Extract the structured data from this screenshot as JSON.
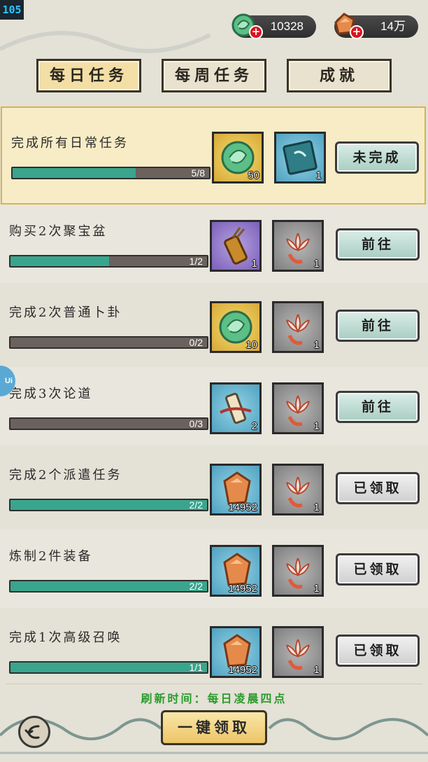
{
  "status": {
    "fps": "105"
  },
  "currency": {
    "jade": {
      "amount": "10328",
      "icon": "jade-coin-icon"
    },
    "crystal": {
      "amount": "14万",
      "icon": "amber-crystal-icon"
    }
  },
  "tabs": [
    {
      "label": "每日任务",
      "active": true
    },
    {
      "label": "每周任务",
      "active": false
    },
    {
      "label": "成就",
      "active": false
    }
  ],
  "tasks": [
    {
      "title": "完成所有日常任务",
      "progress_text": "5/8",
      "progress": 0.625,
      "rewards": [
        {
          "icon": "jade-coin-icon",
          "qty": "50"
        },
        {
          "icon": "scroll-book-icon",
          "qty": "1"
        }
      ],
      "button": "未完成"
    },
    {
      "title": "购买2次聚宝盆",
      "progress_text": "1/2",
      "progress": 0.5,
      "rewards": [
        {
          "icon": "arrow-quiver-icon",
          "qty": "1"
        },
        {
          "icon": "lotus-flower-icon",
          "qty": "1"
        }
      ],
      "button": "前往"
    },
    {
      "title": "完成2次普通卜卦",
      "progress_text": "0/2",
      "progress": 0,
      "rewards": [
        {
          "icon": "jade-coin-icon",
          "qty": "10"
        },
        {
          "icon": "lotus-flower-icon",
          "qty": "1"
        }
      ],
      "button": "前往"
    },
    {
      "title": "完成3次论道",
      "progress_text": "0/3",
      "progress": 0,
      "rewards": [
        {
          "icon": "scroll-tube-icon",
          "qty": "2"
        },
        {
          "icon": "lotus-flower-icon",
          "qty": "1"
        }
      ],
      "button": "前往"
    },
    {
      "title": "完成2个派遣任务",
      "progress_text": "2/2",
      "progress": 1,
      "rewards": [
        {
          "icon": "amber-crystal-icon",
          "qty": "14952"
        },
        {
          "icon": "lotus-flower-icon",
          "qty": "1"
        }
      ],
      "button": "已领取"
    },
    {
      "title": "炼制2件装备",
      "progress_text": "2/2",
      "progress": 1,
      "rewards": [
        {
          "icon": "amber-crystal-icon",
          "qty": "14952"
        },
        {
          "icon": "lotus-flower-icon",
          "qty": "1"
        }
      ],
      "button": "已领取"
    },
    {
      "title": "完成1次高级召唤",
      "progress_text": "1/1",
      "progress": 1,
      "rewards": [
        {
          "icon": "amber-crystal-icon",
          "qty": "14952"
        },
        {
          "icon": "lotus-flower-icon",
          "qty": "1"
        }
      ],
      "button": "已领取"
    }
  ],
  "footer": {
    "refresh_text": "刷新时间：每日凌晨四点",
    "claim_all": "一键领取",
    "back_icon": "back-arrow-icon"
  },
  "side_tab": {
    "label": "Ui"
  }
}
